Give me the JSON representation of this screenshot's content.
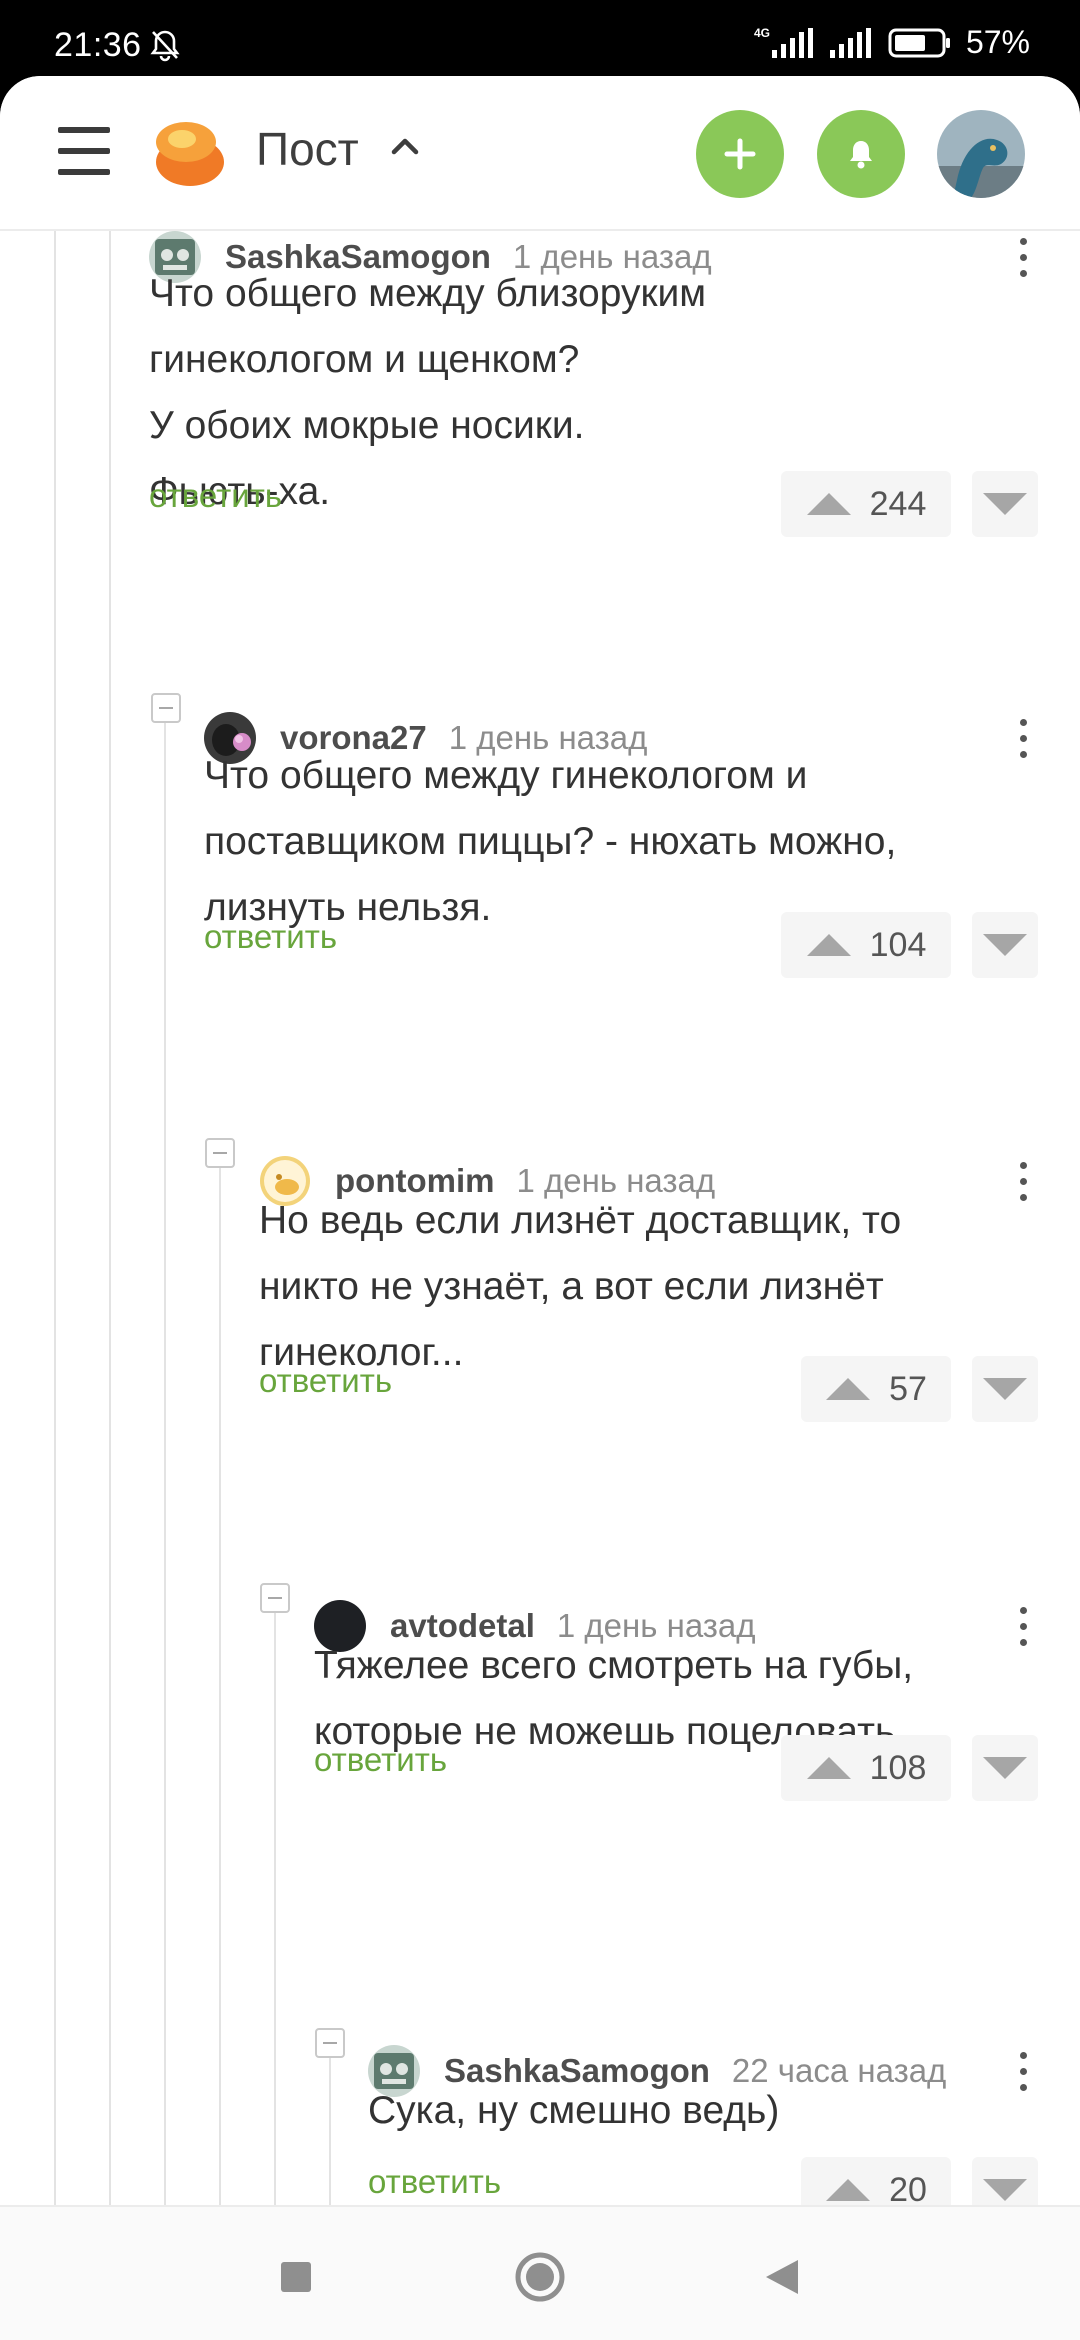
{
  "status_bar": {
    "time": "21:36",
    "network": "4G",
    "battery_percent": "57%",
    "icons": [
      "bell-off-icon",
      "signal-icon",
      "battery-icon"
    ]
  },
  "header": {
    "title": "Пост",
    "icons": [
      "menu-icon",
      "logo-icon",
      "chevron-up-icon",
      "plus-icon",
      "bell-icon",
      "avatar"
    ],
    "accent_color": "#8ac858"
  },
  "comments": [
    {
      "author": "SashkaSamogon",
      "time": "1 день назад",
      "lines": [
        "Что общего между близоруким",
        "гинекологом и щенком?",
        "У обоих мокрые носики.",
        "Фьють-ха."
      ],
      "reply_label": "ответить",
      "rating": "244"
    },
    {
      "author": "vorona27",
      "time": "1 день назад",
      "lines": [
        "Что общего между гинекологом и",
        "поставщиком пиццы? - нюхать можно,",
        "лизнуть нельзя."
      ],
      "reply_label": "ответить",
      "rating": "104"
    },
    {
      "author": "pontomim",
      "time": "1 день назад",
      "lines": [
        "Но ведь если лизнёт доставщик, то",
        "никто не узнаёт, а вот если лизнёт",
        "гинеколог..."
      ],
      "reply_label": "ответить",
      "rating": "57"
    },
    {
      "author": "avtodetal",
      "time": "1 день назад",
      "lines": [
        "Тяжелее всего смотреть на губы,",
        "которые не можешь поцеловать..."
      ],
      "reply_label": "ответить",
      "rating": "108"
    },
    {
      "author": "SashkaSamogon",
      "time": "22 часа назад",
      "lines": [
        "Сука, ну смешно ведь)"
      ],
      "reply_label": "ответить",
      "rating": "20"
    }
  ],
  "navbar": {
    "icons": [
      "recents-icon",
      "home-icon",
      "back-icon"
    ]
  }
}
